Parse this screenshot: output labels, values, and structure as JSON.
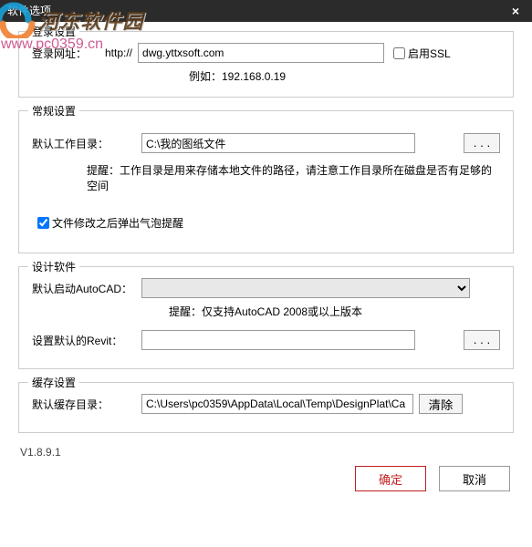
{
  "titlebar": {
    "title": "软件选项",
    "close": "×"
  },
  "watermark": {
    "cn": "河东软件园",
    "url": "www.pc0359.cn"
  },
  "login": {
    "legend": "登录设置",
    "url_label": "登录网址：",
    "http_prefix": "http://",
    "url_value": "dwg.yttxsoft.com",
    "ssl_label": "启用SSL",
    "example": "例如：192.168.0.19"
  },
  "general": {
    "legend": "常规设置",
    "workdir_label": "默认工作目录：",
    "workdir_value": "C:\\我的图纸文件",
    "browse": ". . .",
    "workdir_hint": "提醒：工作目录是用来存储本地文件的路径，请注意工作目录所在磁盘是否有足够的空间",
    "bubble_label": "文件修改之后弹出气泡提醒"
  },
  "design": {
    "legend": "设计软件",
    "autocad_label": "默认启动AutoCAD：",
    "autocad_value": "",
    "autocad_hint": "提醒：仅支持AutoCAD 2008或以上版本",
    "revit_label": "设置默认的Revit：",
    "revit_value": "",
    "browse": ". . ."
  },
  "cache": {
    "legend": "缓存设置",
    "cachedir_label": "默认缓存目录：",
    "cachedir_value": "C:\\Users\\pc0359\\AppData\\Local\\Temp\\DesignPlat\\Ca",
    "clear": "清除"
  },
  "footer": {
    "version": "V1.8.9.1",
    "ok": "确定",
    "cancel": "取消"
  }
}
